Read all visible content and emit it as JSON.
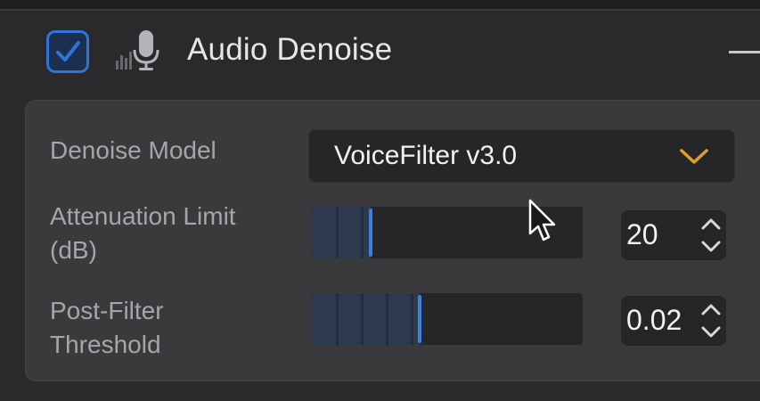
{
  "header": {
    "enabled": true,
    "title": "Audio Denoise",
    "icons": {
      "checkbox": "checkbox-checked-icon",
      "filter": "microphone-levels-icon",
      "collapse": "collapse-minus-icon"
    }
  },
  "settings": {
    "model": {
      "label": "Denoise Model",
      "value": "VoiceFilter v3.0",
      "icon": "chevron-down-icon"
    },
    "attenuation": {
      "label_line1": "Attenuation Limit",
      "label_line2": "(dB)",
      "value": "20",
      "slider_fraction": 0.22
    },
    "post_filter": {
      "label_line1": "Post-Filter",
      "label_line2": "Threshold",
      "value": "0.02",
      "slider_fraction": 0.4
    }
  },
  "colors": {
    "accent": "#3e7fe0",
    "chevron": "#e0a020",
    "panel": "#3a3a3d",
    "field": "#262628"
  }
}
